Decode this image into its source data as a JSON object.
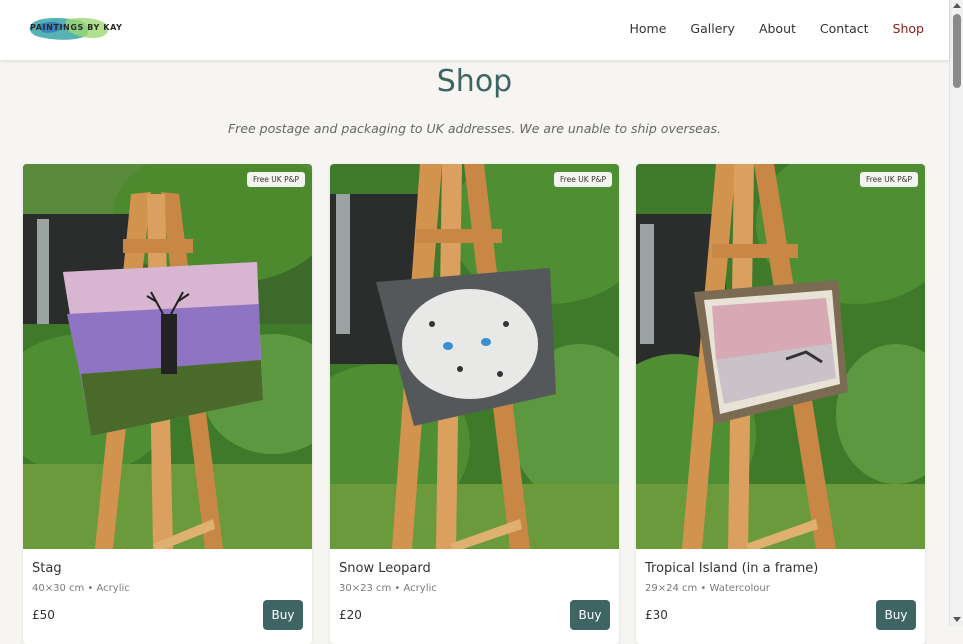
{
  "header": {
    "logo_text": "PAINTINGS BY KAY",
    "nav": [
      "Home",
      "Gallery",
      "About",
      "Contact",
      "Shop"
    ],
    "active_nav": "Shop",
    "accent_color": "#8b1d1d"
  },
  "page": {
    "title": "Shop",
    "subtitle": "Free postage and packaging to UK addresses. We are unable to ship overseas."
  },
  "products": [
    {
      "badge": "Free UK P&P",
      "name": "Stag",
      "details": "40×30 cm • Acrylic",
      "price": "£50",
      "buy_label": "Buy"
    },
    {
      "badge": "Free UK P&P",
      "name": "Snow Leopard",
      "details": "30×23 cm • Acrylic",
      "price": "£20",
      "buy_label": "Buy"
    },
    {
      "badge": "Free UK P&P",
      "name": "Tropical Island (in a frame)",
      "details": "29×24 cm • Watercolour",
      "price": "£30",
      "buy_label": "Buy"
    }
  ],
  "theme": {
    "primary": "#3f6464",
    "background": "#f6f5f2"
  }
}
